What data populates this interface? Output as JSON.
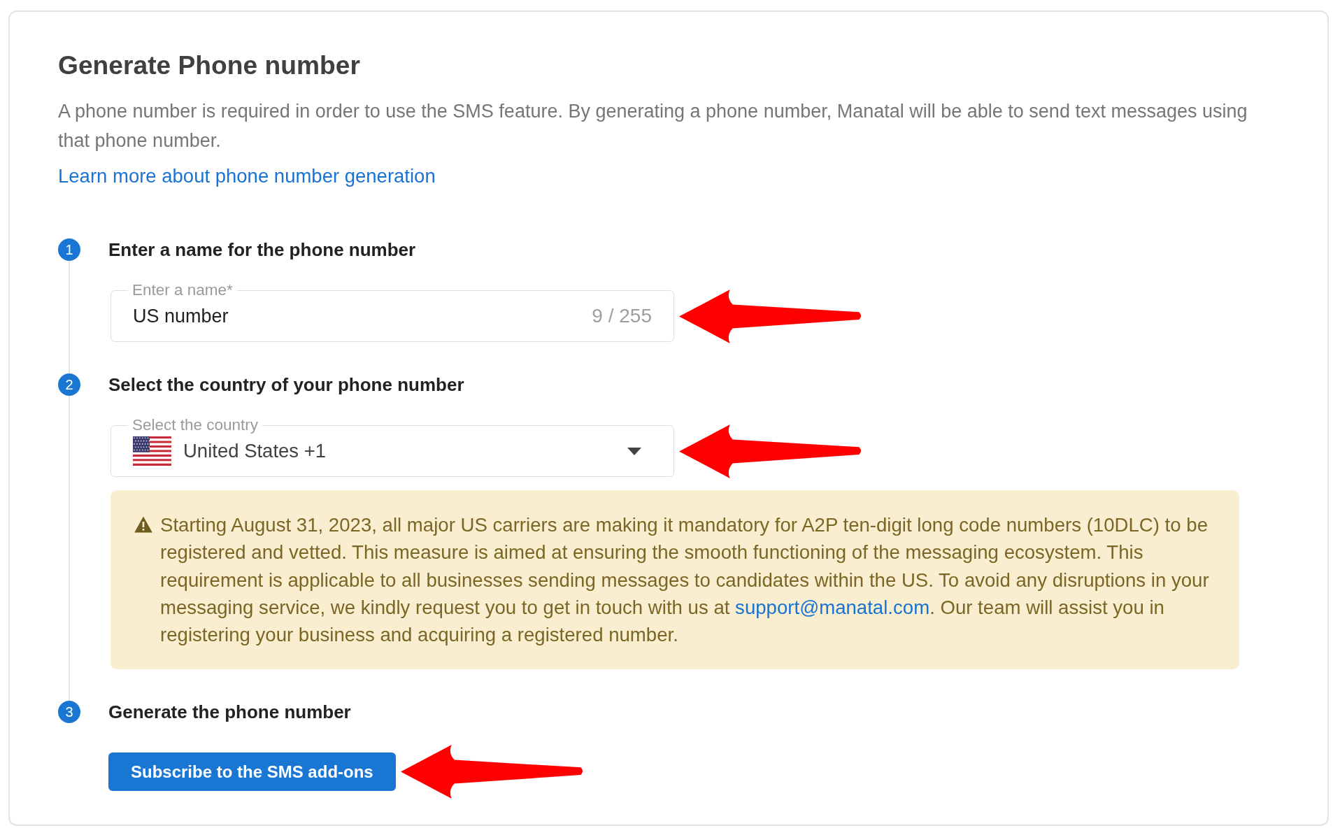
{
  "page": {
    "title": "Generate Phone number",
    "description": "A phone number is required in order to use the SMS feature. By generating a phone number, Manatal will be able to send text messages using that phone number.",
    "link": "Learn more about phone number generation"
  },
  "steps": [
    {
      "number": "1",
      "title": "Enter a name for the phone number",
      "kind": "text_field",
      "field": {
        "label": "Enter a name*",
        "value": "US number",
        "counter": "9 / 255",
        "pointer_arrow": true
      }
    },
    {
      "number": "2",
      "title": "Select the country of your phone number",
      "kind": "select",
      "field": {
        "label": "Select the country",
        "value": "United States +1",
        "pointer_arrow": true
      },
      "notice": {
        "text": "Starting August 31, 2023, all major US carriers are making it mandatory for A2P ten-digit long code numbers (10DLC) to be registered and vetted. This measure is aimed at ensuring the smooth functioning of the messaging ecosystem. This requirement is applicable to all businesses sending messages to candidates within the US. To avoid any disruptions in your messaging service, we kindly request you to get in touch with us at ",
        "link": "support@manatal.com",
        "text_after": ". Our team will assist you in registering your business and acquiring a registered number."
      }
    },
    {
      "number": "3",
      "title": "Generate the phone number",
      "kind": "button",
      "button": {
        "label": "Subscribe to the SMS add-ons",
        "pointer_arrow": true
      }
    }
  ]
}
